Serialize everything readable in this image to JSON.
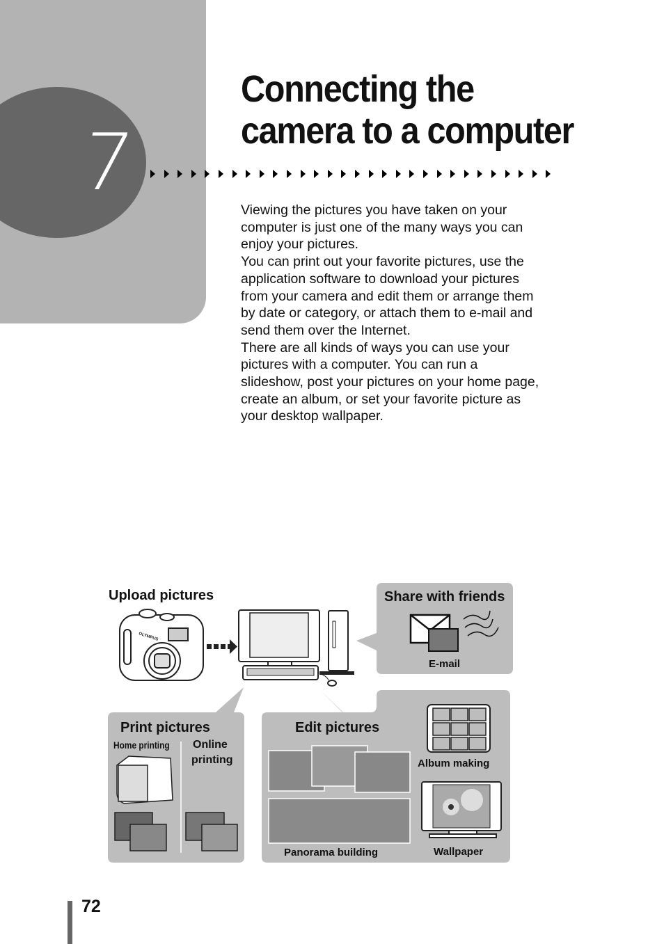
{
  "chapter": {
    "number": "7",
    "title_line1": "Connecting the",
    "title_line2": "camera to a computer"
  },
  "intro": {
    "paragraphs": [
      "Viewing the pictures you have taken on your computer is just one of the many ways you can enjoy your pictures.",
      "You can print out your favorite pictures, use the application software to download your pictures from your camera and edit them or arrange them by date or category, or attach them to e-mail and send them over the Internet.",
      "There are all kinds of ways you can use your pictures with a computer. You can run a slideshow, post your pictures on your home page, create an album, or set your favorite picture as your desktop wallpaper."
    ]
  },
  "diagram": {
    "upload": {
      "label": "Upload pictures",
      "camera_brand": "OLYMPUS"
    },
    "share": {
      "label": "Share with friends",
      "email_label": "E-mail"
    },
    "print": {
      "label": "Print pictures",
      "home_label": "Home printing",
      "online_label_1": "Online",
      "online_label_2": "printing"
    },
    "edit": {
      "label": "Edit pictures",
      "panorama_label": "Panorama building",
      "album_label": "Album making",
      "wallpaper_label": "Wallpaper"
    }
  },
  "footer": {
    "page_number": "72"
  }
}
